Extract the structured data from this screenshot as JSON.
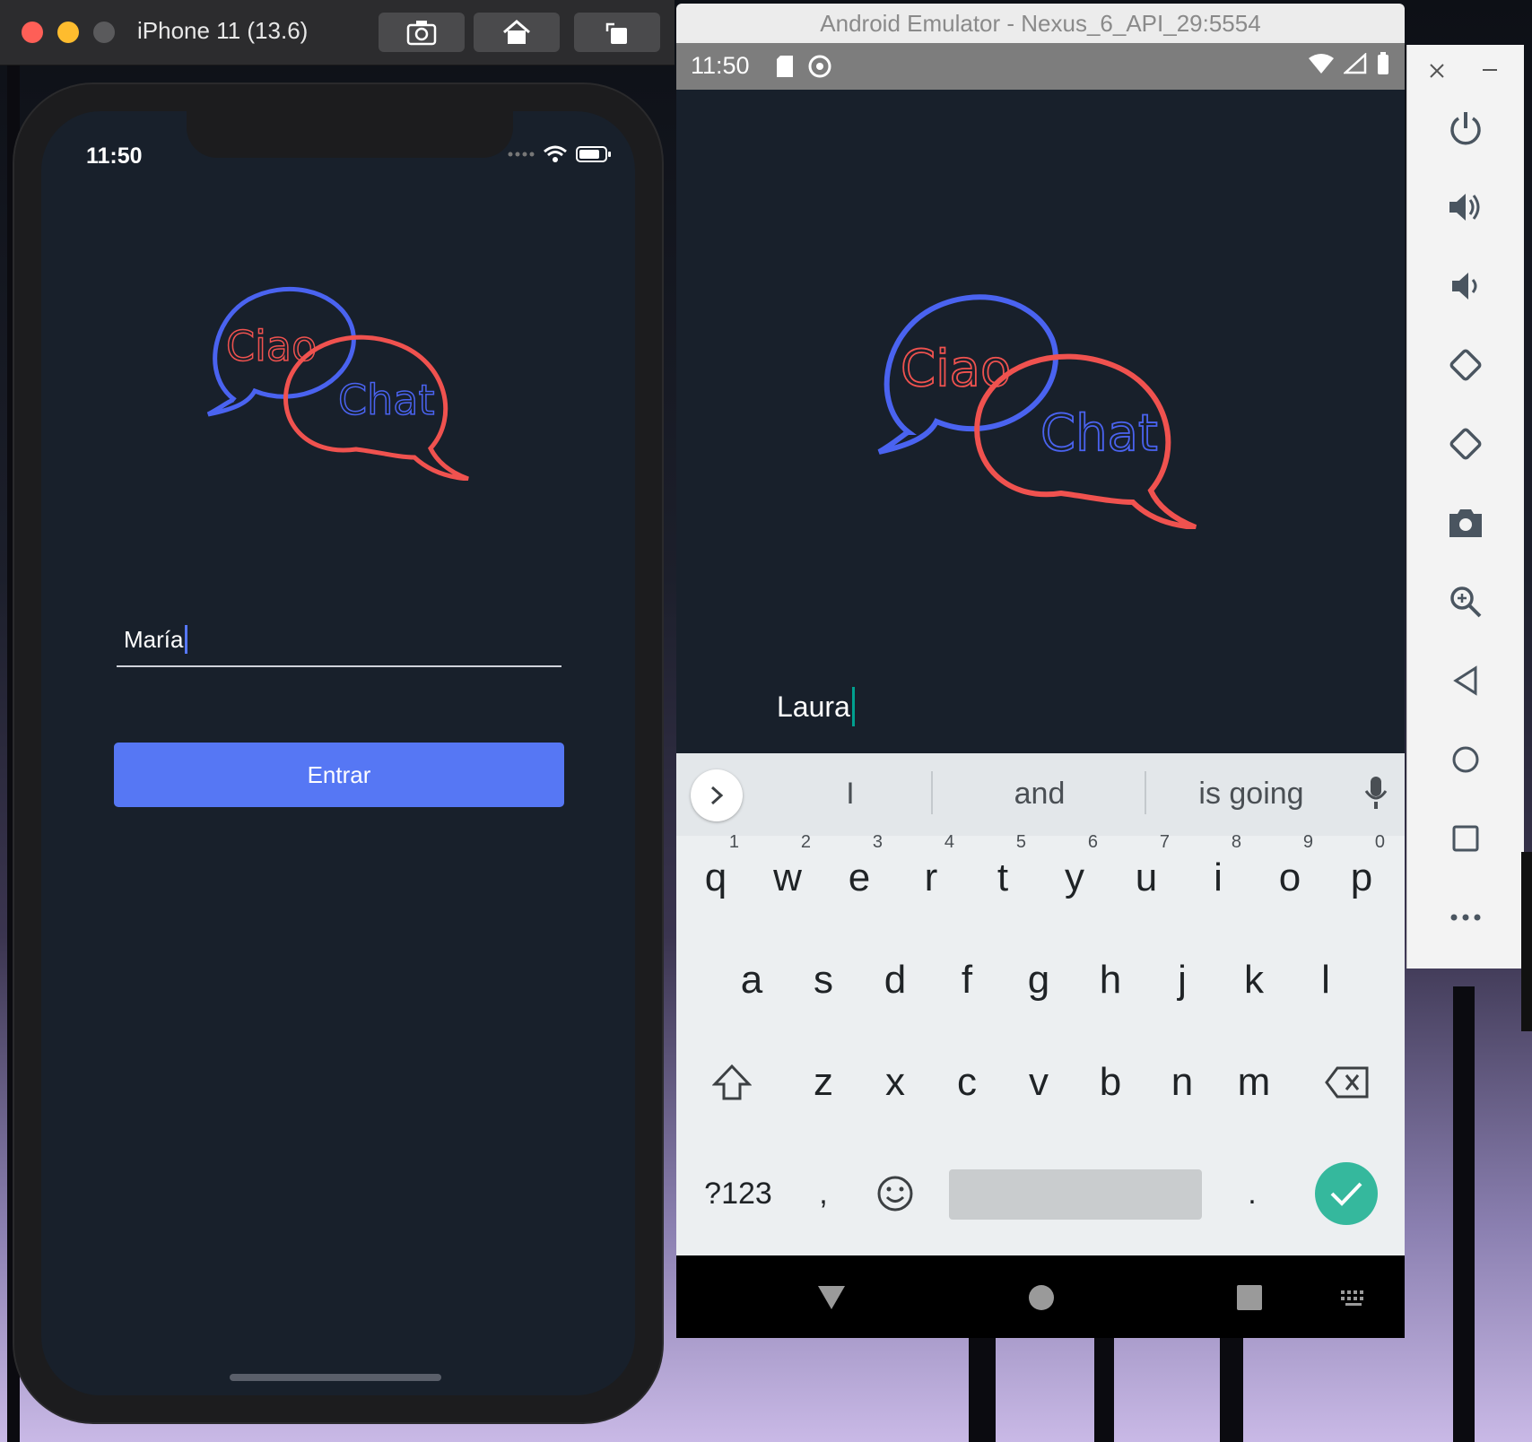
{
  "ios_simulator": {
    "title": "iPhone 11 (13.6)",
    "status_time": "11:50",
    "logo": {
      "word1": "Ciao",
      "word2": "Chat"
    },
    "name_input_value": "María",
    "enter_button_label": "Entrar"
  },
  "android_emulator": {
    "title": "Android Emulator - Nexus_6_API_29:5554",
    "status_time": "11:50",
    "logo": {
      "word1": "Ciao",
      "word2": "Chat"
    },
    "name_input_value": "Laura",
    "keyboard": {
      "suggestions": [
        "I",
        "and",
        "is going"
      ],
      "row1": [
        {
          "key": "q",
          "hint": "1"
        },
        {
          "key": "w",
          "hint": "2"
        },
        {
          "key": "e",
          "hint": "3"
        },
        {
          "key": "r",
          "hint": "4"
        },
        {
          "key": "t",
          "hint": "5"
        },
        {
          "key": "y",
          "hint": "6"
        },
        {
          "key": "u",
          "hint": "7"
        },
        {
          "key": "i",
          "hint": "8"
        },
        {
          "key": "o",
          "hint": "9"
        },
        {
          "key": "p",
          "hint": "0"
        }
      ],
      "row2": [
        "a",
        "s",
        "d",
        "f",
        "g",
        "h",
        "j",
        "k",
        "l"
      ],
      "row3": [
        "z",
        "x",
        "c",
        "v",
        "b",
        "n",
        "m"
      ],
      "symbols_label": "?123",
      "comma": ",",
      "period": "."
    }
  },
  "colors": {
    "app_background": "#18202b",
    "accent_blue": "#5677f4",
    "logo_blue": "#4a63f0",
    "logo_red": "#f0524f",
    "keyboard_enter": "#35b89d"
  },
  "icons": {
    "side_toolbar": [
      "power-icon",
      "volume-up-icon",
      "volume-down-icon",
      "rotate-left-icon",
      "rotate-right-icon",
      "camera-icon",
      "zoom-icon",
      "back-icon",
      "home-icon",
      "overview-icon",
      "more-icon"
    ]
  }
}
